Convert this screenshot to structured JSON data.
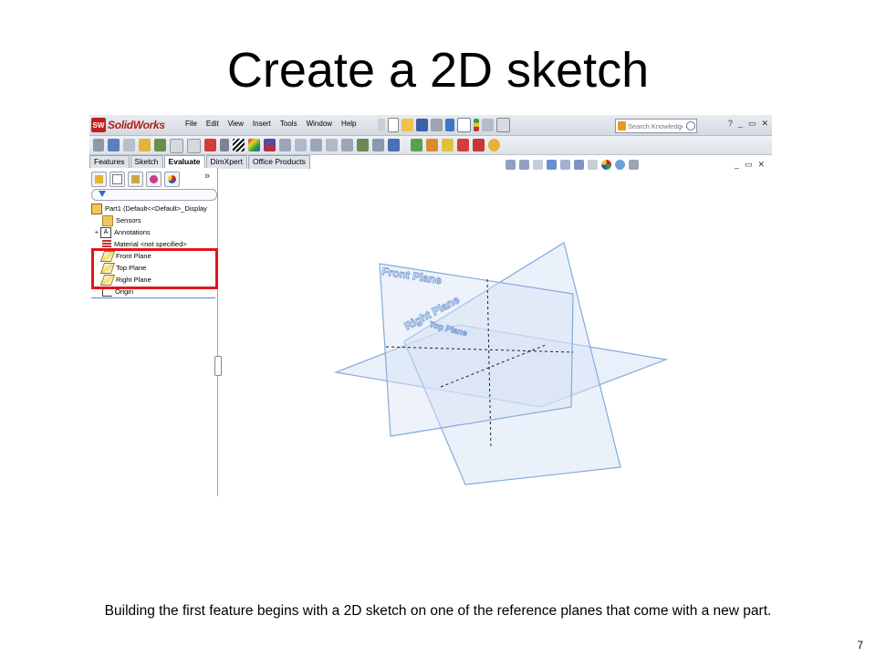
{
  "slide": {
    "title": "Create a 2D sketch",
    "caption": "Building the first feature begins with a 2D sketch on one of the reference planes that come with a new part.",
    "page_number": "7"
  },
  "app": {
    "logo_badge": "SW",
    "logo_text": "SolidWorks",
    "menu": [
      "File",
      "Edit",
      "View",
      "Insert",
      "Tools",
      "Window",
      "Help"
    ],
    "search_placeholder": "Search Knowledge",
    "window_controls": [
      "?",
      "_",
      "▭",
      "✕"
    ]
  },
  "tabs": [
    {
      "label": "Features",
      "active": false
    },
    {
      "label": "Sketch",
      "active": false
    },
    {
      "label": "Evaluate",
      "active": true
    },
    {
      "label": "DimXpert",
      "active": false
    },
    {
      "label": "Office Products",
      "active": false
    }
  ],
  "feature_manager": {
    "part": "Part1  (Default<<Default>_Display",
    "items": [
      "Sensors",
      "Annotations",
      "Material <not specified>",
      "Front Plane",
      "Top Plane",
      "Right Plane",
      "Origin"
    ]
  },
  "graphics": {
    "front_plane_label": "Front Plane",
    "right_plane_label": "Right Plane",
    "top_plane_label": "Top Plane"
  },
  "colors": {
    "plane_fill": "#d7e3f6",
    "plane_edge": "#86a9dc",
    "highlight": "#e3141c",
    "brand": "#c2201c"
  }
}
